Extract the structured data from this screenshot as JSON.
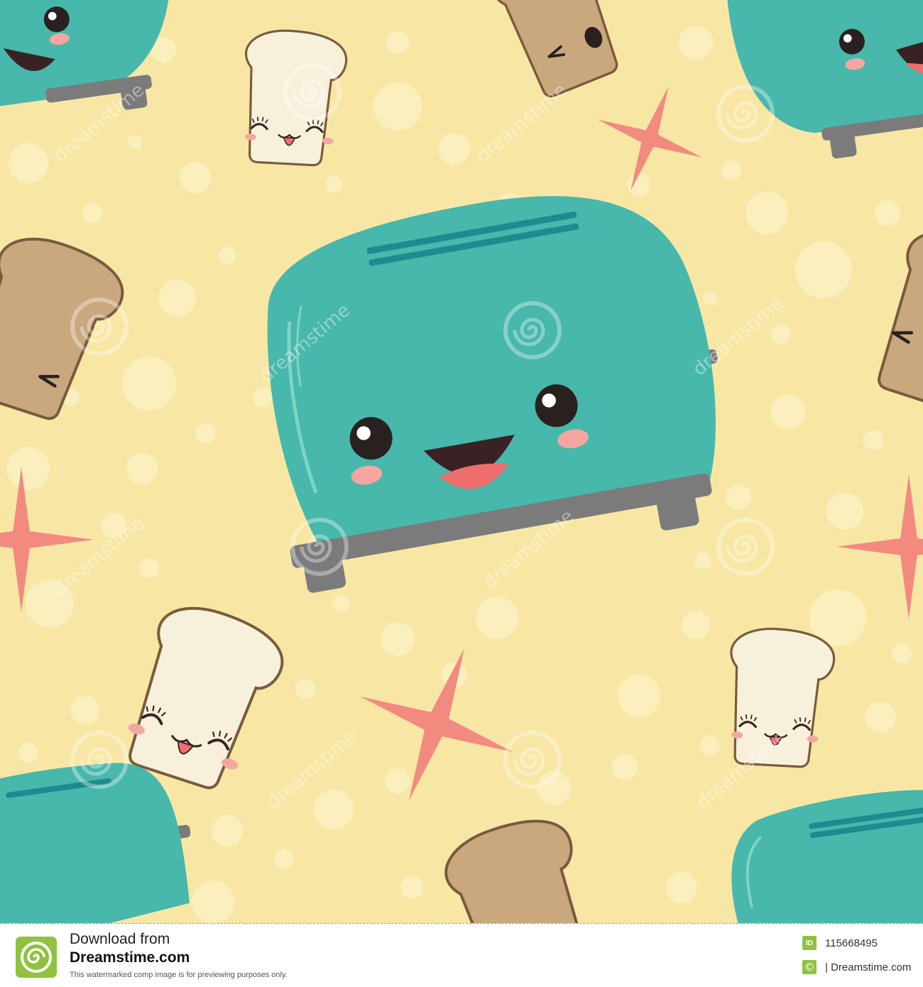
{
  "artwork": {
    "subject": "Seamless pattern of kawaii toasters and toast slices on a dotted yellow background",
    "colors": {
      "background": "#f8e7a4",
      "dots": "#fbefbd",
      "toaster": "#47b8ab",
      "toaster_dark": "#1f8a8f",
      "toaster_base": "#7b7b7b",
      "bread_light": "#f7f1dc",
      "bread_toasted": "#c9a87e",
      "crust": "#7a5a3c",
      "spark": "#f28a80",
      "blush": "#f6a6a0",
      "mouth": "#3a2224",
      "tongue": "#ef6f6f"
    },
    "watermark_text": "dreamstime"
  },
  "footer": {
    "logo_icon": "dreamstime-spiral-logo",
    "download_line1": "Download from",
    "download_line2": "Dreamstime.com",
    "note": "This watermarked comp image is for previewing purposes only.",
    "id_badge": "ID",
    "image_id": "115668495",
    "copyright_icon": "copyright-icon",
    "copyright_symbol": "©",
    "credit": "| Dreamstime.com"
  }
}
